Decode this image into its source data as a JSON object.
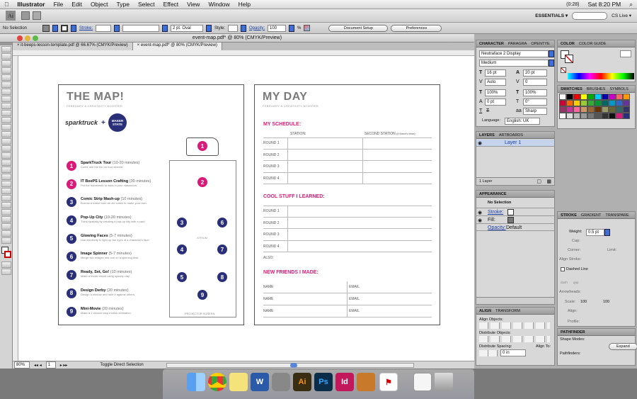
{
  "menubar": {
    "apple": "",
    "app": "Illustrator",
    "items": [
      "File",
      "Edit",
      "Object",
      "Type",
      "Select",
      "Effect",
      "View",
      "Window",
      "Help"
    ],
    "battery": "(0:28)",
    "time": "Sat 8:20 PM"
  },
  "appbar": {
    "workspace": "ESSENTIALS ▾",
    "cslive": "CS Live ▾"
  },
  "control": {
    "selection": "No Selection",
    "stroke_label": "Stroke:",
    "stroke_value": "",
    "profile": "2 pt. Oval",
    "style_label": "Style:",
    "opacity_label": "Opacity:",
    "opacity_value": "100",
    "opacity_unit": "%",
    "doc_setup": "Document Setup",
    "prefs": "Preferences"
  },
  "document": {
    "window_title": "event-map.pdf* @ 80% (CMYK/Preview)",
    "tabs": [
      "it-beeps-lesson-template.pdf @ 66.67% (CMYK/Preview)",
      "event-map.pdf* @ 80% (CMYK/Preview)"
    ]
  },
  "status": {
    "zoom": "80%",
    "page": "1",
    "label": "Toggle Direct Selection"
  },
  "map": {
    "title": "THE MAP!",
    "subtitle": "FEBRUARY & CREATIVITY BOOSTER",
    "logo1": "sparktruck",
    "plus": "+",
    "logo2a": "MAKER",
    "logo2b": "STATE",
    "atrium": "ATRIUM",
    "projector": "PROJECTOR SCREEN",
    "items": [
      {
        "n": "1",
        "title": "SparkTruck Tour",
        "time": "(10-20 minutes)",
        "desc": "Come see the fun on four wheels!"
      },
      {
        "n": "2",
        "title": "IT BeePS Lesson Crafting",
        "time": "(30 minutes)",
        "desc": "Put the framework to work in your classroom."
      },
      {
        "n": "3",
        "title": "Comic Strip Mash-up",
        "time": "(10 minutes)",
        "desc": "Borrow a frame from an old comic to make your own."
      },
      {
        "n": "4",
        "title": "Pop-Up City",
        "time": "(10-20 minutes)",
        "desc": "Think spatially by creating a pop-up city with a card."
      },
      {
        "n": "5",
        "title": "Glowing Faces",
        "time": "(5-7 minutes)",
        "desc": "Use electricity to light up the eyes of a character's face."
      },
      {
        "n": "6",
        "title": "Image Spinner",
        "time": "(5-7 minutes)",
        "desc": "Merge two images into one on a spinning disk."
      },
      {
        "n": "7",
        "title": "Ready, Set, Go!",
        "time": "(10 minutes)",
        "desc": "Make a textile circuit using sparkly clay."
      },
      {
        "n": "8",
        "title": "Design Derby",
        "time": "(20 minutes)",
        "desc": "Design a minicar and race it against others."
      },
      {
        "n": "9",
        "title": "Mini-Movie",
        "time": "(20 minutes)",
        "desc": "Make a 1 second stop motion animation."
      }
    ],
    "truck_number": "1",
    "room_numbers": [
      "2",
      "3",
      "6",
      "4",
      "7",
      "5",
      "8",
      "9"
    ]
  },
  "day": {
    "title": "MY DAY",
    "subtitle": "FEBRUARY & CREATIVITY BOOSTER",
    "schedule_title": "MY SCHEDULE:",
    "station": "STATION:",
    "second_station": "SECOND STATION",
    "second_note": "(if there's time):",
    "rounds": [
      "ROUND 1",
      "ROUND 2",
      "ROUND 3",
      "ROUND 4"
    ],
    "learned_title": "COOL STUFF I LEARNED:",
    "also": "ALSO:",
    "friends_title": "NEW FRIENDS I MADE:",
    "name": "NAME",
    "email": "EMAIL"
  },
  "panels": {
    "character": {
      "tabs": [
        "CHARACTER",
        "PARAGRA",
        "OPENTYE"
      ],
      "font": "Neutraface 2 Display",
      "weight": "Medium",
      "size": "16 pt",
      "leading": "20 pt",
      "kerning": "Auto",
      "tracking": "0",
      "hscale": "100%",
      "vscale": "100%",
      "baseline": "0 pt",
      "rotate": "0°",
      "aa": "Sharp",
      "lang_label": "Language:",
      "lang": "English: UK"
    },
    "color": {
      "tabs": [
        "COLOR",
        "COLOR GUIDE"
      ]
    },
    "swatches": {
      "tabs": [
        "SWATCHES",
        "BRUSHES",
        "SYMBOLS"
      ]
    },
    "layers": {
      "tabs": [
        "LAYERS",
        "ARTBOARDS"
      ],
      "layer": "Layer 1",
      "footer": "1 Layer"
    },
    "appearance": {
      "tab": "APPEARANCE",
      "nosel": "No Selection",
      "stroke": "Stroke:",
      "fill": "Fill:",
      "opacity": "Opacity:",
      "opacity_val": "Default"
    },
    "stroke": {
      "tabs": [
        "STROKE",
        "GRADIENT",
        "TRANSPARE"
      ],
      "weight_label": "Weight:",
      "weight": "0.5 pt",
      "cap": "Cap:",
      "corner": "Corner:",
      "limit": "Limit:",
      "align": "Align Stroke:",
      "dashed": "Dashed Line",
      "dash": "dash",
      "gap": "gap",
      "arrowheads": "Arrowheads:",
      "scale": "Scale:",
      "scale1": "100",
      "scale2": "100",
      "align2": "Align:",
      "profile": "Profile:"
    },
    "gtb": {
      "tabs": [
        "GRADIENT",
        "TRANSPARE"
      ]
    },
    "align": {
      "tabs": [
        "ALIGN",
        "TRANSFORM"
      ],
      "objects": "Align Objects:",
      "distribute": "Distribute Objects:",
      "spacing": "Distribute Spacing:",
      "alignto": "Align To:",
      "spacing_val": "0 in"
    },
    "pathfinder": {
      "tab": "PATHFINDER",
      "modes": "Shape Modes:",
      "pathfinders": "Pathfinders:",
      "expand": "Expand"
    }
  },
  "colors": {
    "magenta": "#d91a78",
    "navy": "#2a2f7a"
  }
}
